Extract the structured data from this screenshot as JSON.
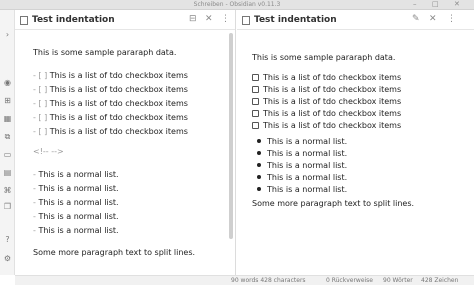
{
  "window": {
    "title": "Schreiben - Obsidian v0.11.3",
    "minimize": "–",
    "maximize": "□",
    "close": "✕"
  },
  "ribbon": {
    "icons": [
      "chevron-right-icon",
      "search-icon",
      "graph-icon",
      "grid-icon",
      "files-icon",
      "calendar-icon",
      "document-icon",
      "command-icon",
      "settings-icon"
    ]
  },
  "left_pane": {
    "title": "Test indentation",
    "icons": {
      "reading": "⊟",
      "close": "✕",
      "more": "⋮"
    },
    "lines": {
      "p1": "This is some sample pararaph data.",
      "c1": "This is a list of tdo checkbox items",
      "c2": "This is a list of tdo checkbox items",
      "c3": "This is a list of tdo checkbox items",
      "c4": "This is a list of tdo checkbox items",
      "c5": "This is a list of tdo checkbox items",
      "comment": "<!-- -->",
      "l1": "This is a normal list.",
      "l2": "This is a normal list.",
      "l3": "This is a normal list.",
      "l4": "This is a normal list.",
      "l5": "This is a normal list.",
      "p2": "Some more paragraph text to split lines."
    },
    "checkbox_prefix": "- [ ]",
    "list_prefix": "-"
  },
  "right_pane": {
    "title": "Test indentation",
    "icons": {
      "edit": "✎",
      "close": "✕",
      "more": "⋮"
    },
    "p1": "This is some sample pararaph data.",
    "checkboxes": [
      "This is a list of tdo checkbox items",
      "This is a list of tdo checkbox items",
      "This is a list of tdo checkbox items",
      "This is a list of tdo checkbox items",
      "This is a list of tdo checkbox items"
    ],
    "bullets": [
      "This is a normal list.",
      "This is a normal list.",
      "This is a normal list.",
      "This is a normal list.",
      "This is a normal list."
    ],
    "p2": "Some more paragraph text to split lines."
  },
  "status": {
    "words_left": "90 words 428 characters",
    "backlinks": "0 Rückverweise",
    "words_right": "90 Wörter",
    "chars_right": "428 Zeichen"
  }
}
